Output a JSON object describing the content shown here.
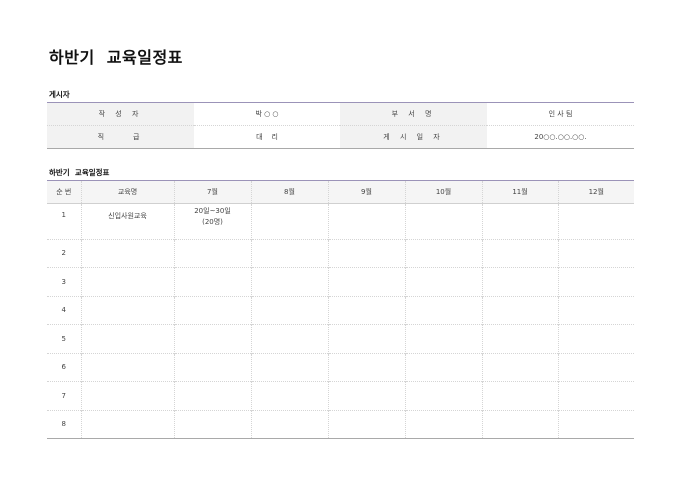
{
  "page": {
    "title": "하반기  교육일정표",
    "section_poster": "게시자",
    "section_schedule": "하반기  교육일정표"
  },
  "info": {
    "author_label": "작 성 자",
    "author_value": "박 ○ ○",
    "dept_label": "부 서 명",
    "dept_value": "인 사 팀",
    "position_label": "직    급",
    "position_value": "대    리",
    "date_label": "게 시 일 자",
    "date_value": "20○○.○○.○○."
  },
  "schedule": {
    "headers": [
      "순 번",
      "교육명",
      "7월",
      "8월",
      "9월",
      "10월",
      "11월",
      "12월"
    ],
    "rows": [
      {
        "no": "1",
        "name": "신입사원교육",
        "jul_line1": "20일~30일",
        "jul_line2": "(20명)"
      },
      {
        "no": "2"
      },
      {
        "no": "3"
      },
      {
        "no": "4"
      },
      {
        "no": "5"
      },
      {
        "no": "6"
      },
      {
        "no": "7"
      },
      {
        "no": "8"
      }
    ]
  }
}
